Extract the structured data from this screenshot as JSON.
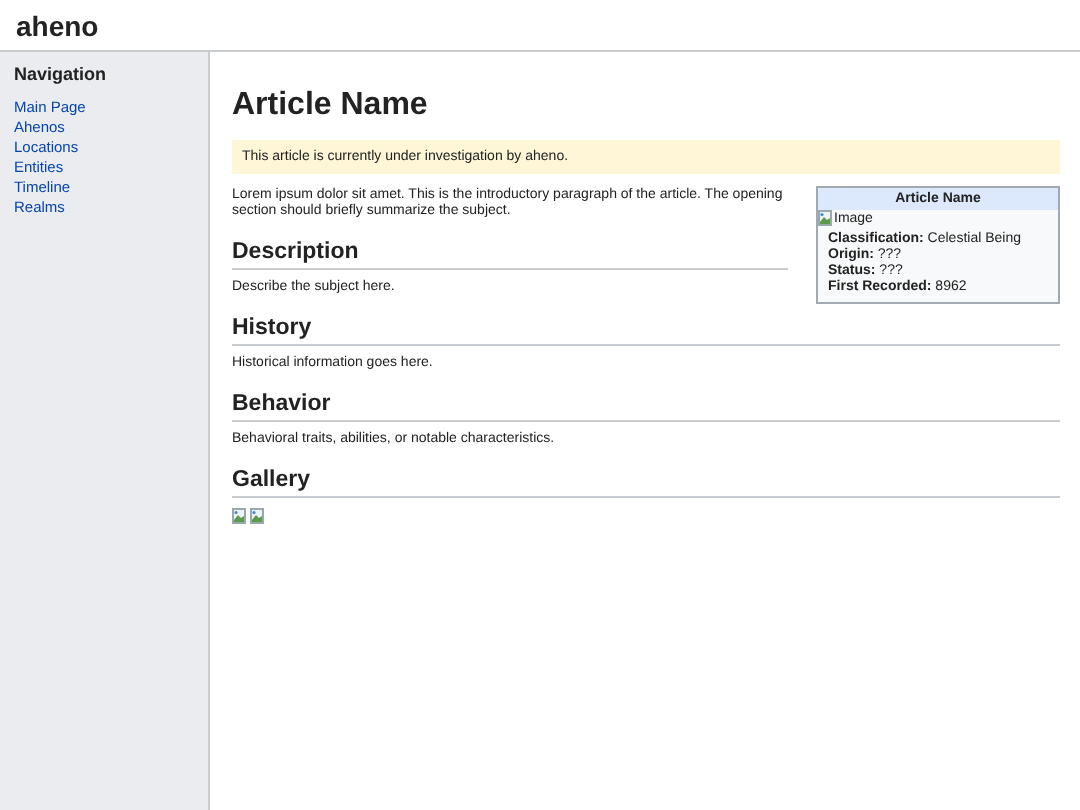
{
  "site_title": "aheno",
  "sidebar": {
    "heading": "Navigation",
    "items": [
      "Main Page",
      "Ahenos",
      "Locations",
      "Entities",
      "Timeline",
      "Realms"
    ]
  },
  "article": {
    "title": "Article Name",
    "notice": "This article is currently under investigation by aheno.",
    "intro": "Lorem ipsum dolor sit amet. This is the introductory paragraph of the article. The opening section should briefly summarize the subject.",
    "infobox": {
      "title": "Article Name",
      "image_alt": "Image",
      "fields": [
        {
          "label": "Classification:",
          "value": "Celestial Being"
        },
        {
          "label": "Origin:",
          "value": "???"
        },
        {
          "label": "Status:",
          "value": "???"
        },
        {
          "label": "First Recorded:",
          "value": "8962"
        }
      ]
    },
    "sections": [
      {
        "heading": "Description",
        "text": "Describe the subject here."
      },
      {
        "heading": "History",
        "text": "Historical information goes here."
      },
      {
        "heading": "Behavior",
        "text": "Behavioral traits, abilities, or notable characteristics."
      },
      {
        "heading": "Gallery"
      }
    ]
  }
}
